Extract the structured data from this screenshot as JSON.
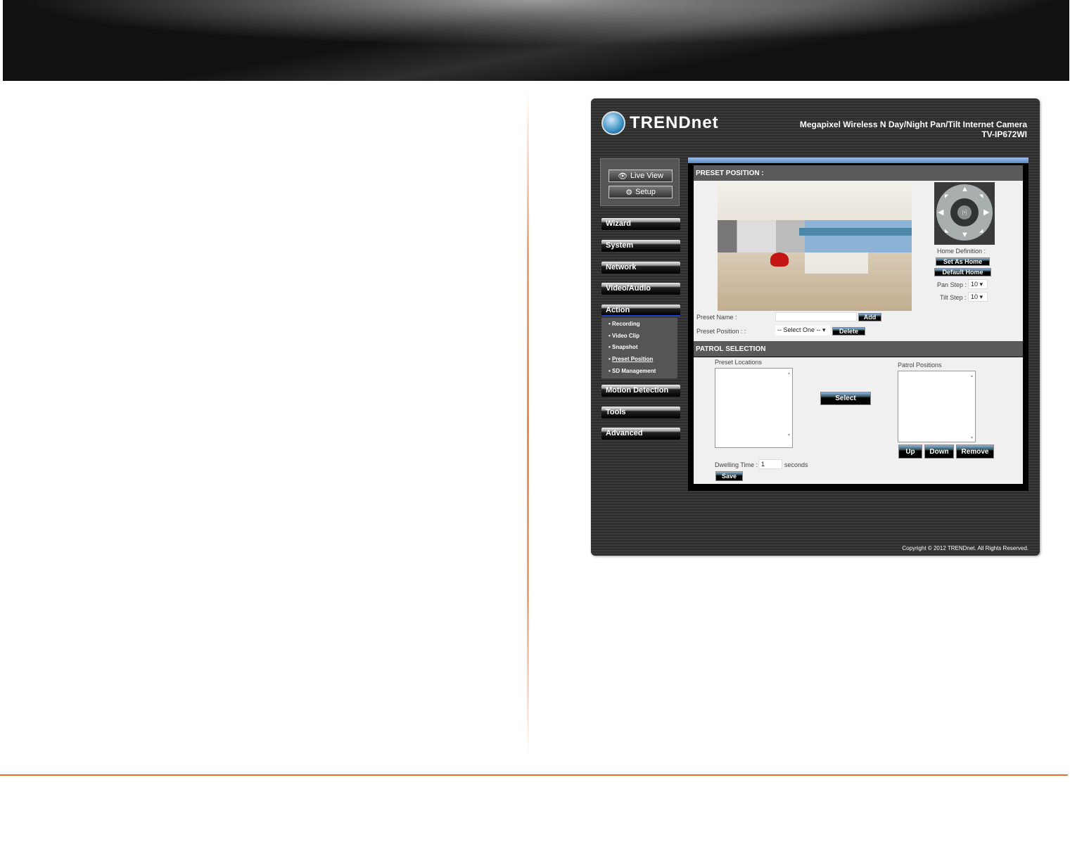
{
  "app": {
    "brand": "TRENDnet",
    "title": "Megapixel Wireless N Day/Night Pan/Tilt Internet Camera",
    "model": "TV-IP672WI",
    "copyright": "Copyright © 2012 TRENDnet. All Rights Reserved."
  },
  "top_buttons": {
    "live_view": "Live View",
    "setup": "Setup"
  },
  "nav": {
    "items": [
      "Wizard",
      "System",
      "Network",
      "Video/Audio",
      "Action",
      "Motion Detection",
      "Tools",
      "Advanced"
    ],
    "active": "Action",
    "action_sub": [
      "Recording",
      "Video Clip",
      "Snapshot",
      "Preset Position",
      "SD Management"
    ],
    "current_sub": "Preset Position"
  },
  "preset": {
    "header": "PRESET POSITION :",
    "home_definition": "Home Definition :",
    "set_as_home": "Set As Home",
    "default_home": "Default Home",
    "pan_step_label": "Pan Step :",
    "pan_step": "10",
    "tilt_step_label": "Tilt Step :",
    "tilt_step": "10",
    "preset_name_label": "Preset Name :",
    "preset_name_value": "",
    "add": "Add",
    "preset_position_label": "Preset Position : :",
    "preset_position_value": "-- Select One --",
    "delete": "Delete",
    "ptz_center": "[•]"
  },
  "patrol": {
    "header": "PATROL SELECTION",
    "preset_locations": "Preset Locations",
    "patrol_positions": "Patrol Positions",
    "select": "Select",
    "up": "Up",
    "down": "Down",
    "remove": "Remove",
    "dwelling_label": "Dwelling Time :",
    "dwelling_value": "1",
    "seconds": "seconds",
    "save": "Save"
  }
}
